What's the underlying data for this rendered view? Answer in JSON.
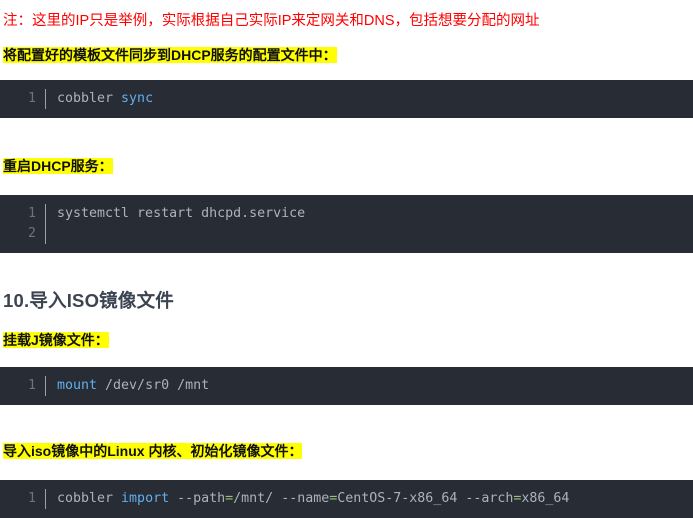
{
  "document": {
    "note": "注：这里的IP只是举例，实际根据自己实际IP来定网关和DNS，包括想要分配的网址",
    "headings": {
      "sync_template": "将配置好的模板文件同步到DHCP服务的配置文件中：",
      "restart_dhcp": "重启DHCP服务：",
      "section_10": "10.导入ISO镜像文件",
      "mount_iso": "挂载J镜像文件：",
      "import_iso": "导入iso镜像中的Linux 内核、初始化镜像文件："
    },
    "code_blocks": [
      {
        "name": "cobbler-sync",
        "lines": [
          {
            "number": "1",
            "tokens": [
              {
                "text": "cobbler ",
                "type": "plain"
              },
              {
                "text": "sync",
                "type": "keyword"
              }
            ]
          }
        ]
      },
      {
        "name": "restart-dhcpd",
        "lines": [
          {
            "number": "1",
            "tokens": [
              {
                "text": "systemctl restart dhcpd.service",
                "type": "plain"
              }
            ]
          },
          {
            "number": "2",
            "tokens": [
              {
                "text": "",
                "type": "plain"
              }
            ]
          }
        ]
      },
      {
        "name": "mount-sr0",
        "lines": [
          {
            "number": "1",
            "tokens": [
              {
                "text": "mount",
                "type": "keyword"
              },
              {
                "text": " /dev/sr0 /mnt",
                "type": "plain"
              }
            ]
          }
        ]
      },
      {
        "name": "cobbler-import",
        "lines": [
          {
            "number": "1",
            "tokens": [
              {
                "text": "cobbler ",
                "type": "plain"
              },
              {
                "text": "import",
                "type": "keyword"
              },
              {
                "text": " --path",
                "type": "plain"
              },
              {
                "text": "=",
                "type": "operator"
              },
              {
                "text": "/mnt/ --name",
                "type": "plain"
              },
              {
                "text": "=",
                "type": "operator"
              },
              {
                "text": "CentOS-7-x86_64 --arch",
                "type": "plain"
              },
              {
                "text": "=",
                "type": "operator"
              },
              {
                "text": "x86_64",
                "type": "plain"
              }
            ]
          }
        ]
      }
    ],
    "colors": {
      "note_red": "#ff0000",
      "highlight_yellow": "#ffff00",
      "heading_slate": "#3c4351",
      "code_background": "#282c34",
      "code_text": "#abb2bf",
      "code_keyword": "#61afef",
      "code_operator": "#98c379",
      "line_number": "#6b7280"
    }
  }
}
